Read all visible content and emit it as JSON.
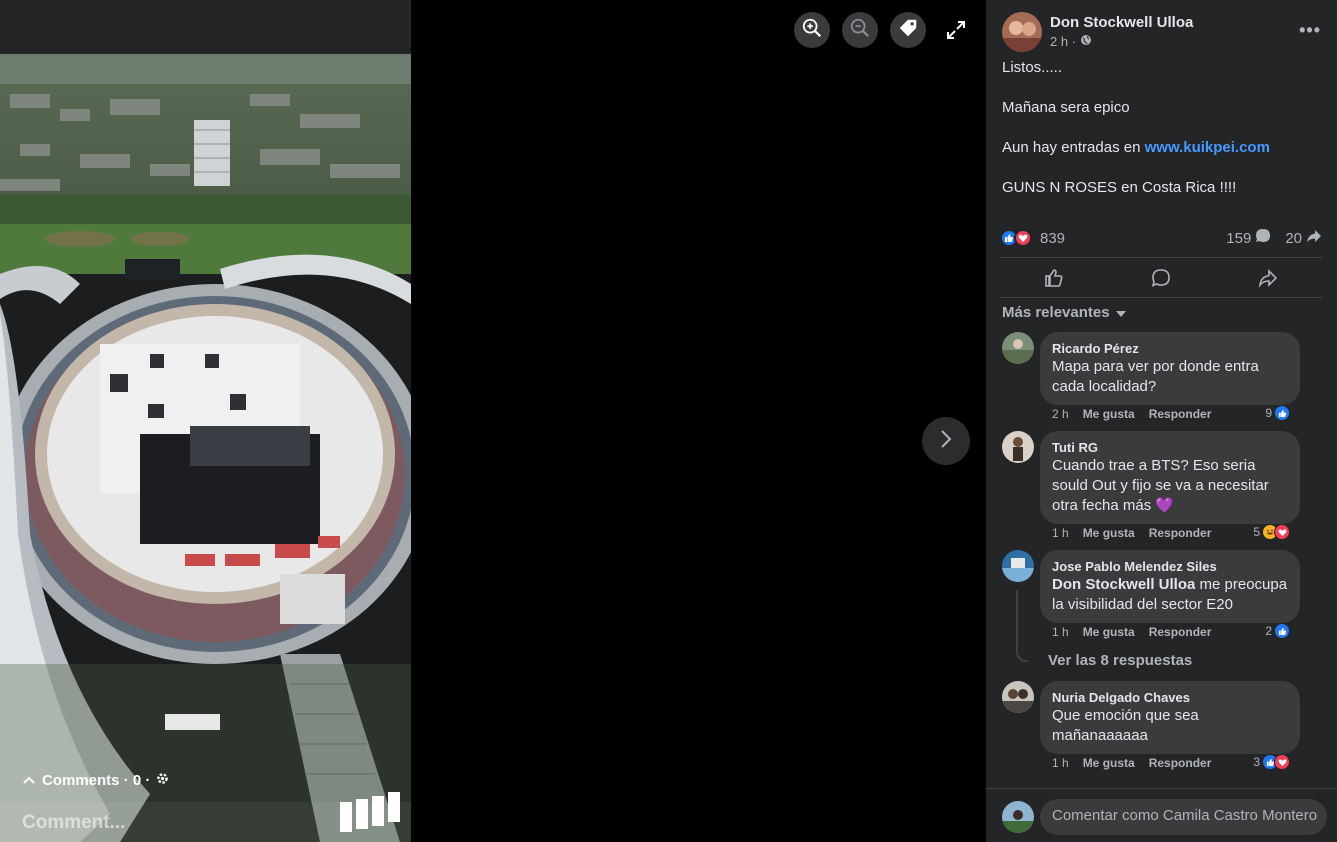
{
  "media": {
    "overlay": {
      "comments_label": "Comments · 0 ·",
      "comment_placeholder": "Comment..."
    },
    "icons": [
      "zoom-in-icon",
      "zoom-out-icon",
      "tag-icon",
      "expand-icon",
      "chevron-right-icon"
    ]
  },
  "post": {
    "author": "Don Stockwell Ulloa",
    "time": "2 h ·",
    "lines": [
      "Listos.....",
      "Mañana sera epico",
      "Aun hay entradas en",
      "GUNS N ROSES en Costa Rica !!!!"
    ],
    "link": "www.kuikpei.com",
    "reactions_count": "839",
    "comments_count": "159",
    "shares_count": "20"
  },
  "comments_section": {
    "sort_label": "Más relevantes",
    "view_replies": "Ver las 8 respuestas",
    "like_label": "Me gusta",
    "reply_label": "Responder",
    "items": [
      {
        "author": "Ricardo Pérez",
        "text": "Mapa para ver por donde entra cada localidad?",
        "time": "2 h",
        "reactions": "9"
      },
      {
        "author": "Tuti RG",
        "text": "Cuando trae a BTS? Eso seria sould Out y fijo se va a necesitar otra fecha más 💜",
        "time": "1 h",
        "reactions": "5"
      },
      {
        "author": "Jose Pablo Melendez Siles",
        "mention": "Don Stockwell Ulloa",
        "text": " me preocupa la visibilidad del sector E20",
        "time": "1 h",
        "reactions": "2"
      },
      {
        "author": "Nuria Delgado Chaves",
        "text": "Que emoción que sea mañanaaaaaa",
        "time": "1 h",
        "reactions": "3"
      }
    ]
  },
  "compose": {
    "placeholder": "Comentar como Camila Castro Montero"
  },
  "colors": {
    "panel_bg": "#242526",
    "bubble_bg": "#3a3b3c",
    "link": "#4599ff",
    "like": "#2078f4",
    "love": "#f33e58"
  }
}
